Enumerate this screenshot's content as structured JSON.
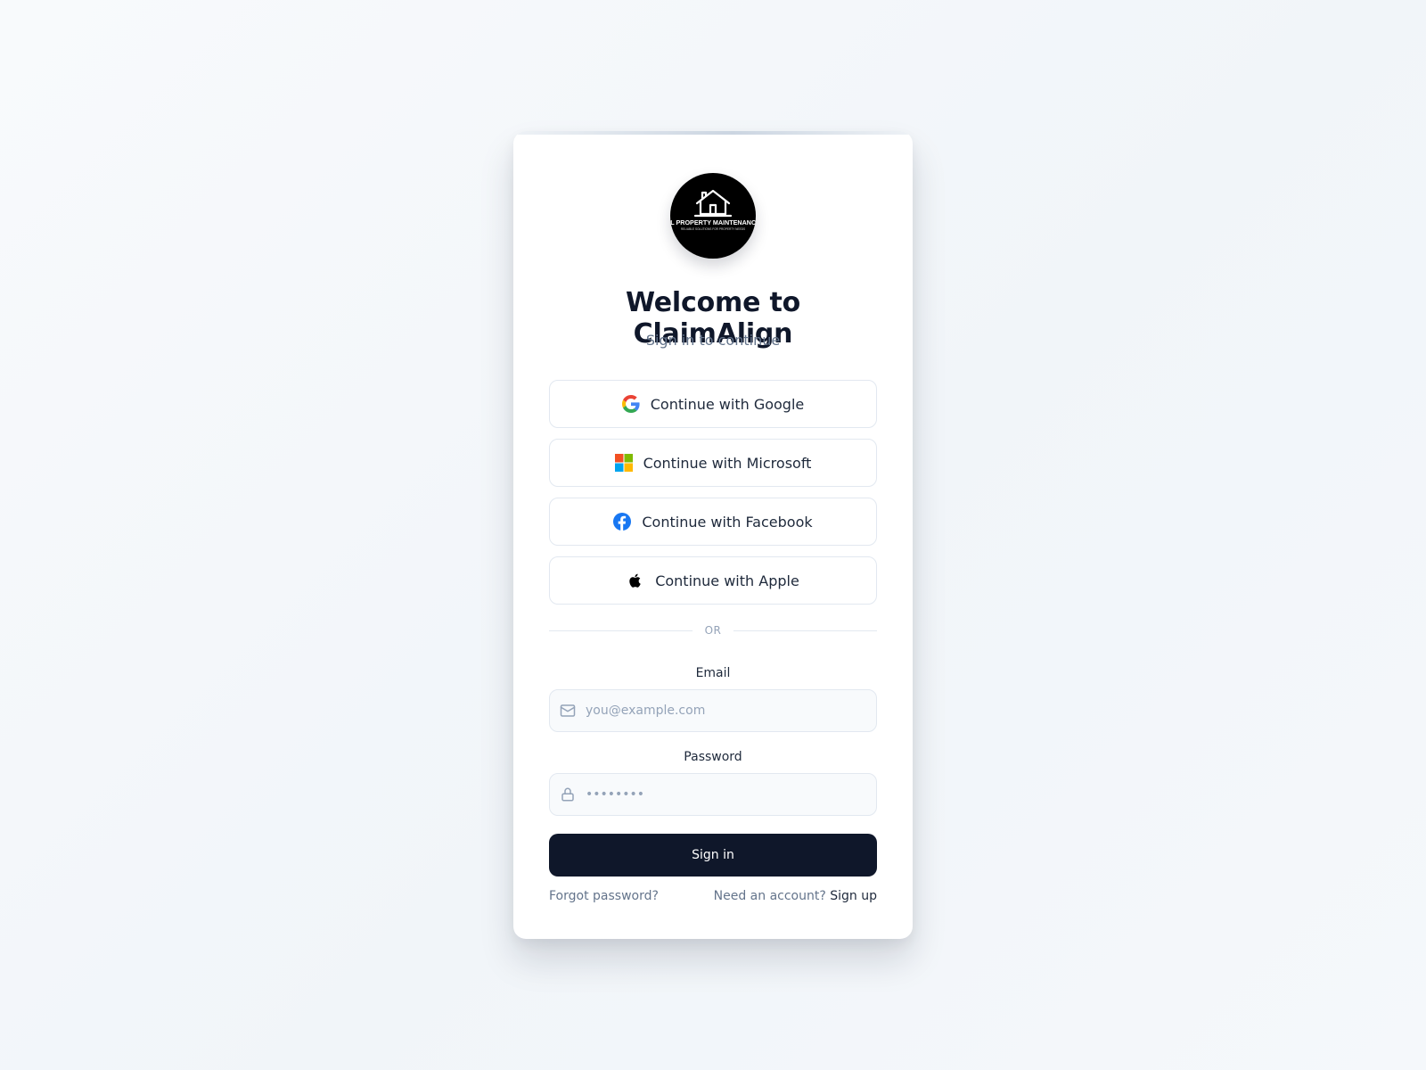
{
  "logo": {
    "line1": "BL PROPERTY MAINTENANCE",
    "line2": "RELIABLE SOLUTIONS FOR PROPERTY NEEDS"
  },
  "header": {
    "title": "Welcome to ClaimAlign",
    "subtitle": "Sign in to continue"
  },
  "oauth": {
    "google_label": "Continue with Google",
    "microsoft_label": "Continue with Microsoft",
    "facebook_label": "Continue with Facebook",
    "apple_label": "Continue with Apple"
  },
  "divider": {
    "text": "OR"
  },
  "form": {
    "email_label": "Email",
    "email_placeholder": "you@example.com",
    "email_value": "",
    "password_label": "Password",
    "password_placeholder": "••••••••",
    "password_value": "",
    "submit_label": "Sign in"
  },
  "footer": {
    "forgot_label": "Forgot password?",
    "need_account_text": "Need an account?",
    "signup_label": "Sign up"
  },
  "colors": {
    "primary": "#0f172a",
    "facebook": "#1877f2",
    "google_blue": "#4285f4",
    "google_red": "#ea4335",
    "google_yellow": "#fbbc05",
    "google_green": "#34a853",
    "microsoft_red": "#f25022",
    "microsoft_green": "#7fba00",
    "microsoft_blue": "#00a4ef",
    "microsoft_yellow": "#ffb900"
  },
  "icons": [
    "house-logo-icon",
    "google-icon",
    "microsoft-icon",
    "facebook-icon",
    "apple-icon",
    "mail-icon",
    "lock-icon"
  ]
}
